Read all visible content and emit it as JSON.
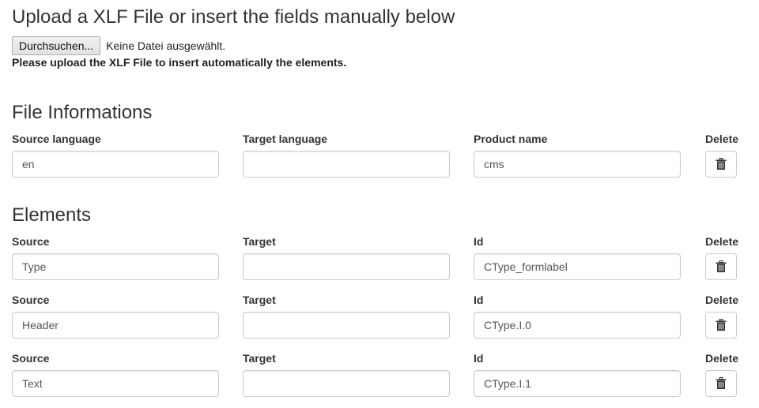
{
  "header": {
    "title": "Upload a XLF File or insert the fields manually below",
    "browse_button": "Durchsuchen...",
    "file_status": "Keine Datei ausgewählt.",
    "hint": "Please upload the XLF File to insert automatically the elements."
  },
  "file_info": {
    "title": "File Informations",
    "labels": {
      "source_language": "Source language",
      "target_language": "Target language",
      "product_name": "Product name",
      "delete": "Delete"
    },
    "values": {
      "source_language": "en",
      "target_language": "",
      "product_name": "cms"
    },
    "delete_icon": "trash-icon"
  },
  "elements": {
    "title": "Elements",
    "labels": {
      "source": "Source",
      "target": "Target",
      "id": "Id",
      "delete": "Delete"
    },
    "rows": [
      {
        "source": "Type",
        "target": "",
        "id": "CType_formlabel"
      },
      {
        "source": "Header",
        "target": "",
        "id": "CType.I.0"
      },
      {
        "source": "Text",
        "target": "",
        "id": "CType.I.1"
      }
    ]
  }
}
